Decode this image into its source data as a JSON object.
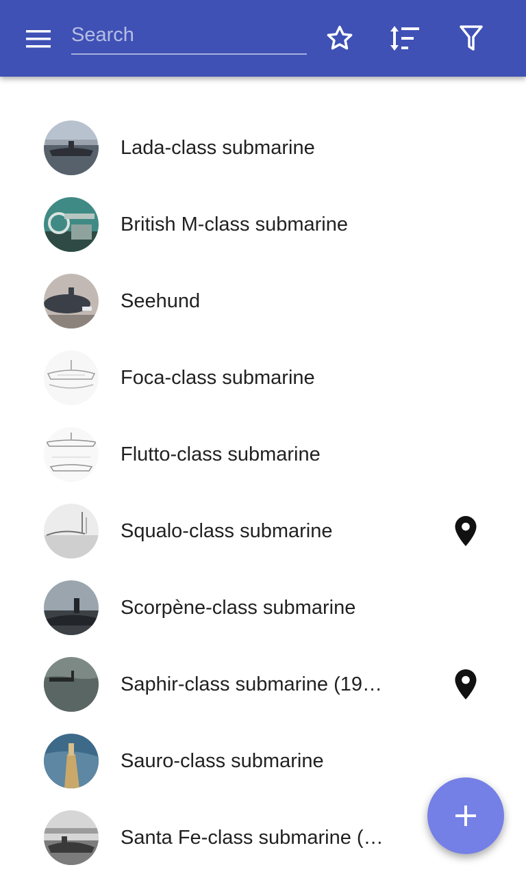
{
  "appbar": {
    "search_placeholder": "Search",
    "search_value": "",
    "accent_color": "#3f51b5"
  },
  "items": [
    {
      "label": "Lada-class submarine",
      "has_location": false,
      "thumb": "submarine-photo"
    },
    {
      "label": "British M-class submarine",
      "has_location": false,
      "thumb": "submarine-gun-photo"
    },
    {
      "label": "Seehund",
      "has_location": false,
      "thumb": "midget-submarine-photo"
    },
    {
      "label": "Foca-class submarine",
      "has_location": false,
      "thumb": "submarine-drawing"
    },
    {
      "label": "Flutto-class submarine",
      "has_location": false,
      "thumb": "submarine-drawing"
    },
    {
      "label": "Squalo-class submarine",
      "has_location": true,
      "thumb": "submarine-sketch"
    },
    {
      "label": "Scorpène-class submarine",
      "has_location": false,
      "thumb": "submarine-photo"
    },
    {
      "label": "Saphir-class submarine (19…",
      "has_location": true,
      "thumb": "submarine-sea-photo"
    },
    {
      "label": "Sauro-class submarine",
      "has_location": false,
      "thumb": "submarine-aerial-photo"
    },
    {
      "label": "Santa Fe-class submarine (…",
      "has_location": false,
      "thumb": "submarine-harbor-photo"
    }
  ],
  "fab": {
    "icon": "add-icon",
    "color": "#7480e6"
  }
}
